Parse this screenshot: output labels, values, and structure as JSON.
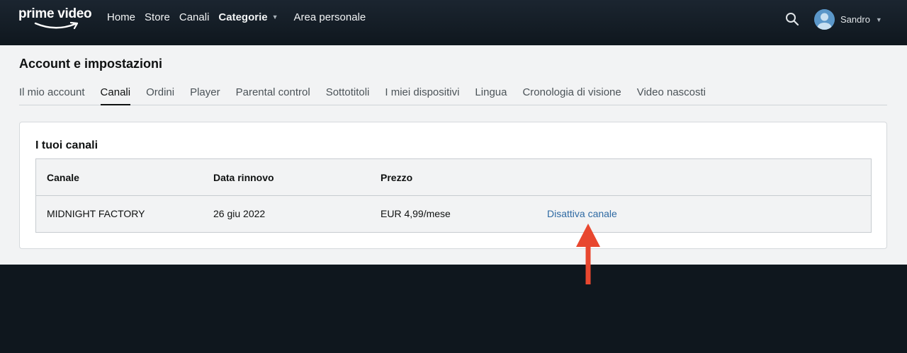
{
  "header": {
    "logo_text": "prime video",
    "nav": {
      "home": "Home",
      "store": "Store",
      "canali": "Canali",
      "categorie": "Categorie",
      "area": "Area personale"
    },
    "profile_name": "Sandro",
    "icons": {
      "search": "search-icon",
      "avatar": "avatar-icon",
      "caret": "chevron-down-icon"
    }
  },
  "page": {
    "title": "Account e impostazioni",
    "tabs": [
      "Il mio account",
      "Canali",
      "Ordini",
      "Player",
      "Parental control",
      "Sottotitoli",
      "I miei dispositivi",
      "Lingua",
      "Cronologia di visione",
      "Video nascosti"
    ],
    "active_tab": "Canali"
  },
  "channels": {
    "title": "I tuoi canali",
    "columns": [
      "Canale",
      "Data rinnovo",
      "Prezzo"
    ],
    "rows": [
      {
        "channel": "MIDNIGHT FACTORY",
        "renewal": "26 giu 2022",
        "price": "EUR 4,99/mese",
        "action": "Disattiva canale"
      }
    ]
  },
  "colors": {
    "nav_bg": "#0f171e",
    "link": "#2f6aa3",
    "annotation_arrow": "#e8472f"
  }
}
